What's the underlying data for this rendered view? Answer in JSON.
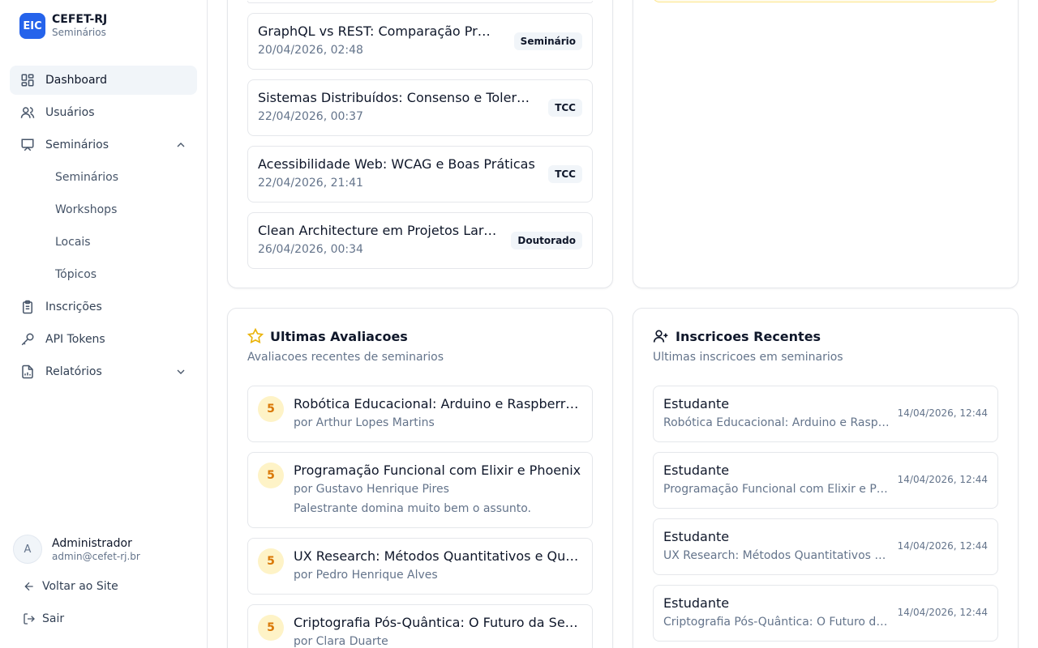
{
  "brand": {
    "logo": "EIC",
    "name": "CEFET-RJ",
    "sub": "Seminários"
  },
  "nav": {
    "dashboard": "Dashboard",
    "usuarios": "Usuários",
    "seminarios": "Seminários",
    "sub": [
      "Seminários",
      "Workshops",
      "Locais",
      "Tópicos"
    ],
    "inscricoes": "Inscrições",
    "tokens": "API Tokens",
    "relatorios": "Relatórios"
  },
  "user": {
    "initial": "A",
    "name": "Administrador",
    "email": "admin@cefet-rj.br"
  },
  "footer": {
    "back": "Voltar ao Site",
    "logout": "Sair"
  },
  "upcoming": [
    {
      "title": "GraphQL vs REST: Comparação Prática",
      "date": "20/04/2026, 02:48",
      "badge": "Seminário"
    },
    {
      "title": "Sistemas Distribuídos: Consenso e Tolerância a Falhas",
      "date": "22/04/2026, 00:37",
      "badge": "TCC"
    },
    {
      "title": "Acessibilidade Web: WCAG e Boas Práticas",
      "date": "22/04/2026, 21:41",
      "badge": "TCC"
    },
    {
      "title": "Clean Architecture em Projetos Larga Escala",
      "date": "26/04/2026, 00:34",
      "badge": "Doutorado"
    }
  ],
  "reviews": {
    "title": "Ultimas Avaliacoes",
    "desc": "Avaliacoes recentes de seminarios",
    "items": [
      {
        "score": "5",
        "title": "Robótica Educacional: Arduino e Raspberry Pi",
        "by": "por Arthur Lopes Martins",
        "comment": ""
      },
      {
        "score": "5",
        "title": "Programação Funcional com Elixir e Phoenix",
        "by": "por Gustavo Henrique Pires",
        "comment": "Palestrante domina muito bem o assunto."
      },
      {
        "score": "5",
        "title": "UX Research: Métodos Quantitativos e Qualitativos",
        "by": "por Pedro Henrique Alves",
        "comment": ""
      },
      {
        "score": "5",
        "title": "Criptografia Pós-Quântica: O Futuro da Segurança",
        "by": "por Clara Duarte",
        "comment": ""
      }
    ]
  },
  "registrations": {
    "title": "Inscricoes Recentes",
    "desc": "Ultimas inscricoes em seminarios",
    "items": [
      {
        "role": "Estudante",
        "seminar": "Robótica Educacional: Arduino e Raspberry Pi",
        "time": "14/04/2026, 12:44"
      },
      {
        "role": "Estudante",
        "seminar": "Programação Funcional com Elixir e Phoenix",
        "time": "14/04/2026, 12:44"
      },
      {
        "role": "Estudante",
        "seminar": "UX Research: Métodos Quantitativos e Qualitativos",
        "time": "14/04/2026, 12:44"
      },
      {
        "role": "Estudante",
        "seminar": "Criptografia Pós-Quântica: O Futuro da Segurança",
        "time": "14/04/2026, 12:44"
      }
    ]
  },
  "colors": {
    "brand": "#2563eb",
    "star": "#eab308",
    "rating_bg": "#fef3c7",
    "rating_fg": "#d97706"
  }
}
